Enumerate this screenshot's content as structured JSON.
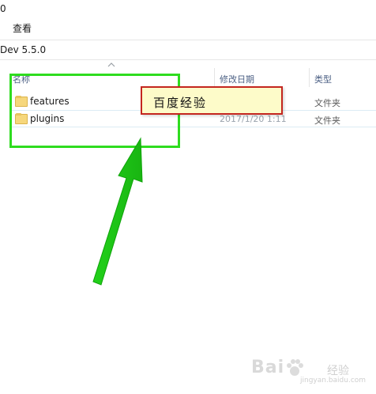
{
  "window": {
    "title_fragment": "0"
  },
  "ribbon": {
    "view_tab": "查看"
  },
  "address": {
    "path": "Dev 5.5.0"
  },
  "columns": {
    "name": "名称",
    "modified": "修改日期",
    "type": "类型"
  },
  "files": [
    {
      "name": "features",
      "date": "",
      "type": "文件夹"
    },
    {
      "name": "plugins",
      "date": "2017/1/20 1:11",
      "type": "文件夹"
    }
  ],
  "callout": {
    "text": "百度经验"
  },
  "watermark": {
    "brand": "Bai",
    "cn": "经验",
    "url": "jingyan.baidu.com"
  },
  "colors": {
    "highlight": "#2fdc1f",
    "callout_border": "#c4261f",
    "callout_bg": "#fdfbc9"
  }
}
